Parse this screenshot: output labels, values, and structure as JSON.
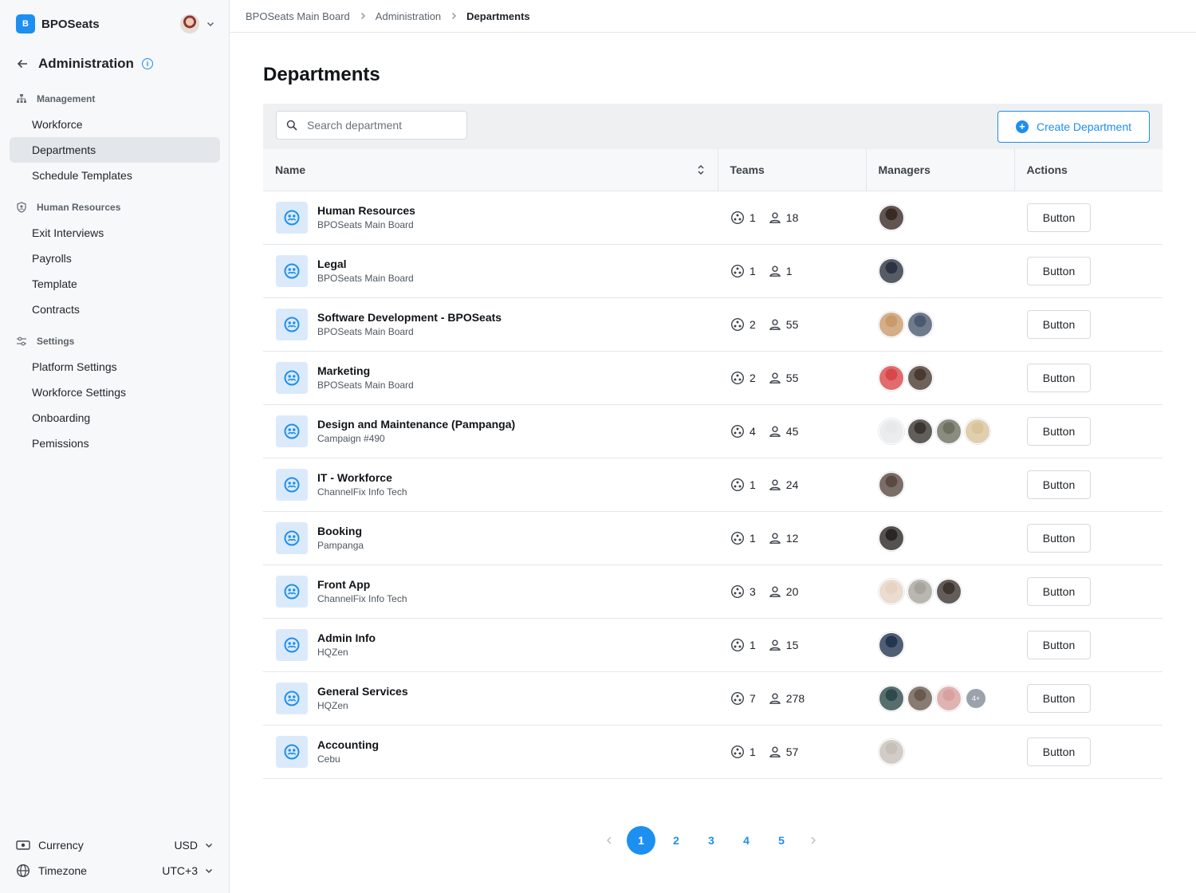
{
  "app": {
    "brand_initial": "B",
    "brand_name": "BPOSeats"
  },
  "sidebar": {
    "back_title": "Administration",
    "info_glyph": "i",
    "sections": [
      {
        "title": "Management",
        "icon": "hierarchy-icon",
        "items": [
          "Workforce",
          "Departments",
          "Schedule Templates"
        ]
      },
      {
        "title": "Human Resources",
        "icon": "shield-user-icon",
        "items": [
          "Exit Interviews",
          "Payrolls",
          "Template",
          "Contracts"
        ]
      },
      {
        "title": "Settings",
        "icon": "sliders-icon",
        "items": [
          "Platform Settings",
          "Workforce Settings",
          "Onboarding",
          "Pemissions"
        ]
      }
    ],
    "active_item": "Departments",
    "footer": {
      "currency": {
        "label": "Currency",
        "value": "USD"
      },
      "timezone": {
        "label": "Timezone",
        "value": "UTC+3"
      }
    }
  },
  "breadcrumb": [
    "BPOSeats Main Board",
    "Administration",
    "Departments"
  ],
  "page": {
    "title": "Departments",
    "search_placeholder": "Search department",
    "create_button": "Create Department"
  },
  "table": {
    "columns": [
      "Name",
      "Teams",
      "Managers",
      "Actions"
    ],
    "action_label": "Button",
    "rows": [
      {
        "name": "Human Resources",
        "sub": "BPOSeats Main Board",
        "teams": "1",
        "people": "18",
        "managers": [
          "#3a2a26"
        ],
        "more": ""
      },
      {
        "name": "Legal",
        "sub": "BPOSeats Main Board",
        "teams": "1",
        "people": "1",
        "managers": [
          "#2b3440"
        ],
        "more": ""
      },
      {
        "name": "Software Development - BPOSeats",
        "sub": "BPOSeats Main Board",
        "teams": "2",
        "people": "55",
        "managers": [
          "#c99a6a",
          "#4b5a70"
        ],
        "more": ""
      },
      {
        "name": "Marketing",
        "sub": "BPOSeats Main Board",
        "teams": "2",
        "people": "55",
        "managers": [
          "#d8484a",
          "#4a3a30"
        ],
        "more": ""
      },
      {
        "name": "Design and Maintenance (Pampanga)",
        "sub": "Campaign #490",
        "teams": "4",
        "people": "45",
        "managers": [
          "#e6e8ea",
          "#3b3530",
          "#6e7060",
          "#d9c39a"
        ],
        "more": ""
      },
      {
        "name": "IT - Workforce",
        "sub": "ChannelFix Info Tech",
        "teams": "1",
        "people": "24",
        "managers": [
          "#5a4a42"
        ],
        "more": ""
      },
      {
        "name": "Booking",
        "sub": "Pampanga",
        "teams": "1",
        "people": "12",
        "managers": [
          "#2a2624"
        ],
        "more": ""
      },
      {
        "name": "Front App",
        "sub": "ChannelFix Info Tech",
        "teams": "3",
        "people": "20",
        "managers": [
          "#e6d3c4",
          "#a8a49c",
          "#3e3430"
        ],
        "more": ""
      },
      {
        "name": "Admin Info",
        "sub": "HQZen",
        "teams": "1",
        "people": "15",
        "managers": [
          "#243552"
        ],
        "more": ""
      },
      {
        "name": "General Services",
        "sub": "HQZen",
        "teams": "7",
        "people": "278",
        "managers": [
          "#2e4a4a",
          "#6a5a4e",
          "#d8a0a0"
        ],
        "more": "4+"
      },
      {
        "name": "Accounting",
        "sub": "Cebu",
        "teams": "1",
        "people": "57",
        "managers": [
          "#c7c0b8"
        ],
        "more": ""
      }
    ]
  },
  "pagination": {
    "pages": [
      "1",
      "2",
      "3",
      "4",
      "5"
    ],
    "current": "1"
  },
  "colors": {
    "accent": "#1d8ff0",
    "active_nav": "#e3e6ea",
    "toolbar_bg": "#eef0f2"
  }
}
